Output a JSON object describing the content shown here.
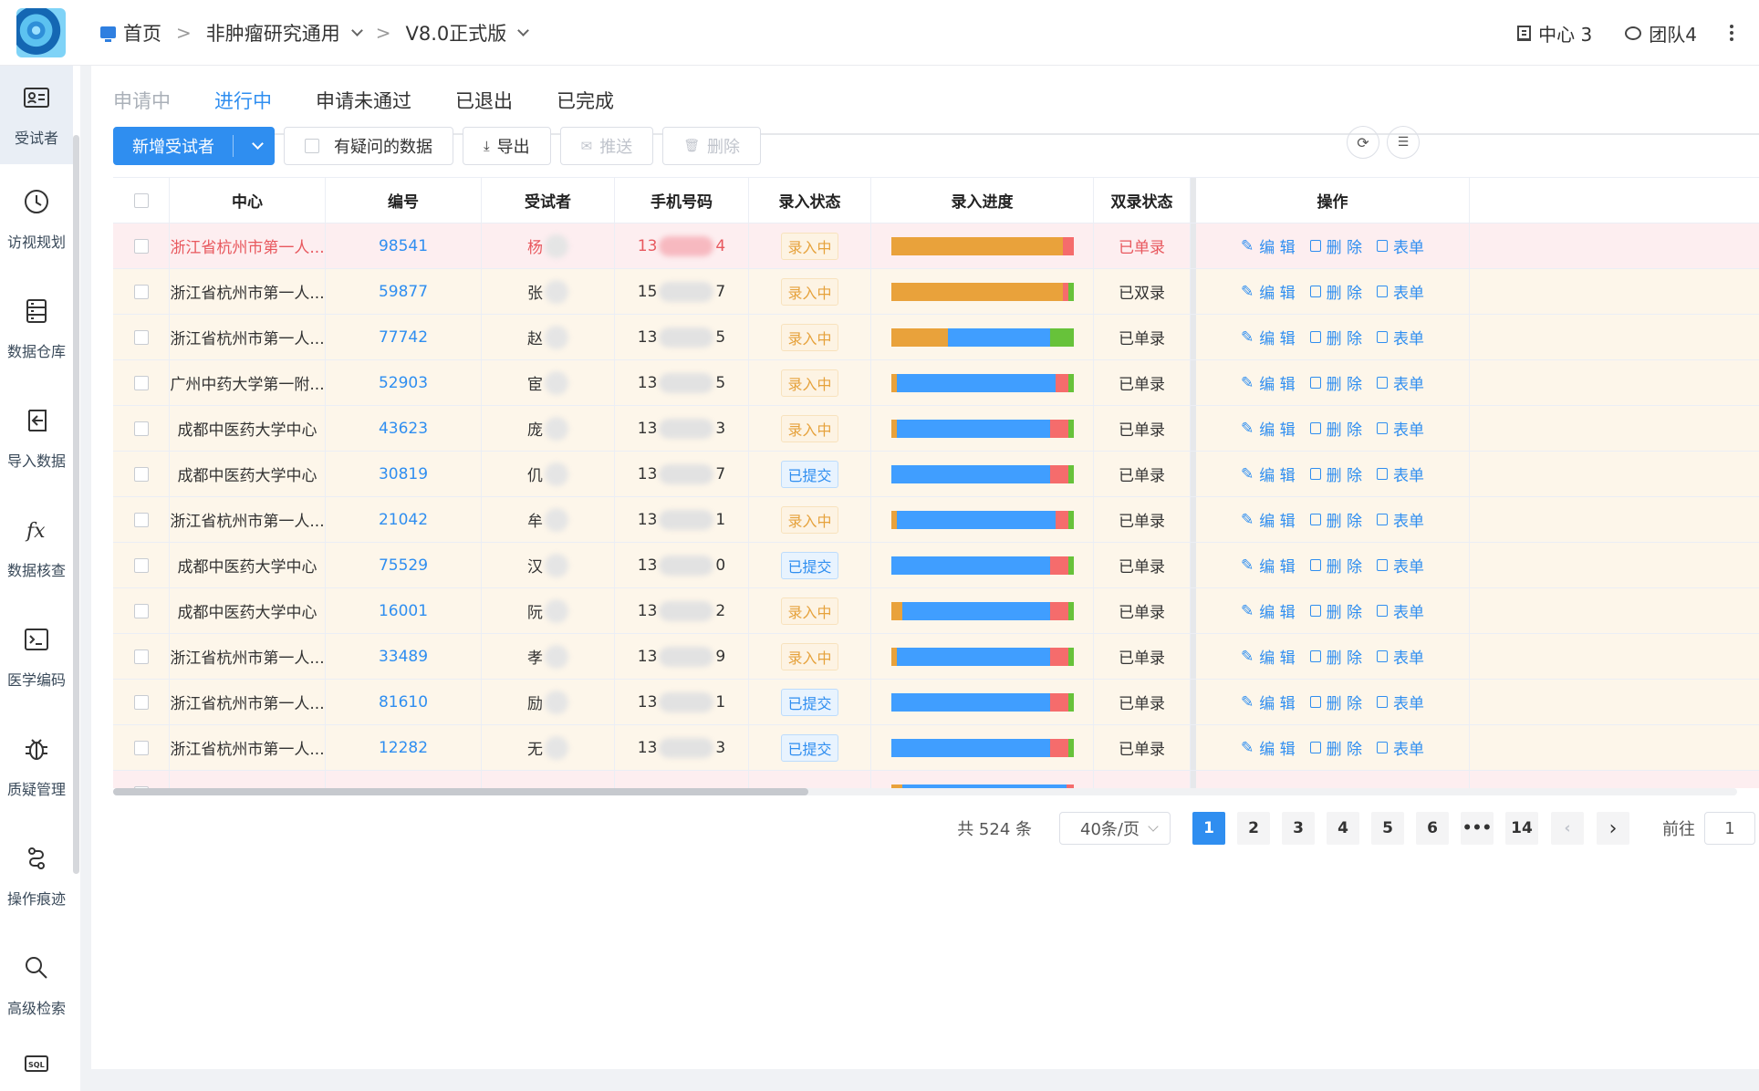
{
  "header": {
    "breadcrumb": [
      "首页",
      "非肿瘤研究通用",
      "V8.0正式版"
    ],
    "center_count": "中心 3",
    "team_count": "团队4"
  },
  "sidebar": {
    "items": [
      {
        "label": "受试者",
        "icon": "id-card-icon"
      },
      {
        "label": "访视规划",
        "icon": "clock-icon"
      },
      {
        "label": "数据仓库",
        "icon": "database-icon"
      },
      {
        "label": "导入数据",
        "icon": "import-icon"
      },
      {
        "label": "数据核查",
        "icon": "fx-icon"
      },
      {
        "label": "医学编码",
        "icon": "terminal-icon"
      },
      {
        "label": "质疑管理",
        "icon": "bug-icon"
      },
      {
        "label": "操作痕迹",
        "icon": "trail-icon"
      },
      {
        "label": "高级检索",
        "icon": "search-icon"
      },
      {
        "label": "",
        "icon": "sql-icon"
      }
    ]
  },
  "tabs": [
    "申请中",
    "进行中",
    "申请未通过",
    "已退出",
    "已完成"
  ],
  "toolbar": {
    "add": "新增受试者",
    "doubtful": "有疑问的数据",
    "export": "导出",
    "push": "推送",
    "delete": "删除"
  },
  "table": {
    "columns": [
      "中心",
      "编号",
      "受试者",
      "手机号码",
      "录入状态",
      "录入进度",
      "双录状态",
      "操作"
    ],
    "ops": {
      "edit": "编 辑",
      "delete": "删 除",
      "form": "表单"
    },
    "colors": {
      "orange": "#e9a23b",
      "blue": "#409eff",
      "red": "#f56c6c",
      "green": "#67c23a"
    },
    "rows": [
      {
        "center": "浙江省杭州市第一人...",
        "code": "98541",
        "name": "杨",
        "phone_pre": "13",
        "phone_suf": "4",
        "status": "录入中",
        "dual": "已单录",
        "progress": [
          0.94,
          0,
          0.06,
          0
        ],
        "style": "pink"
      },
      {
        "center": "浙江省杭州市第一人...",
        "code": "59877",
        "name": "张",
        "phone_pre": "15",
        "phone_suf": "7",
        "status": "录入中",
        "dual": "已双录",
        "progress": [
          0.94,
          0,
          0.03,
          0.03
        ],
        "style": "cream"
      },
      {
        "center": "浙江省杭州市第一人...",
        "code": "77742",
        "name": "赵",
        "phone_pre": "13",
        "phone_suf": "5",
        "status": "录入中",
        "dual": "已单录",
        "progress": [
          0.31,
          0.56,
          0,
          0.13
        ],
        "style": "cream"
      },
      {
        "center": "广州中药大学第一附...",
        "code": "52903",
        "name": "宦",
        "phone_pre": "13",
        "phone_suf": "5",
        "status": "录入中",
        "dual": "已单录",
        "progress": [
          0.03,
          0.87,
          0.07,
          0.03
        ],
        "style": "cream"
      },
      {
        "center": "成都中医药大学中心",
        "code": "43623",
        "name": "庞",
        "phone_pre": "13",
        "phone_suf": "3",
        "status": "录入中",
        "dual": "已单录",
        "progress": [
          0.03,
          0.84,
          0.1,
          0.03
        ],
        "style": "cream"
      },
      {
        "center": "成都中医药大学中心",
        "code": "30819",
        "name": "仉",
        "phone_pre": "13",
        "phone_suf": "7",
        "status": "已提交",
        "dual": "已单录",
        "progress": [
          0,
          0.87,
          0.1,
          0.03
        ],
        "style": "cream"
      },
      {
        "center": "浙江省杭州市第一人...",
        "code": "21042",
        "name": "牟",
        "phone_pre": "13",
        "phone_suf": "1",
        "status": "录入中",
        "dual": "已单录",
        "progress": [
          0.03,
          0.87,
          0.07,
          0.03
        ],
        "style": "cream"
      },
      {
        "center": "成都中医药大学中心",
        "code": "75529",
        "name": "汉",
        "phone_pre": "13",
        "phone_suf": "0",
        "status": "已提交",
        "dual": "已单录",
        "progress": [
          0,
          0.87,
          0.1,
          0.03
        ],
        "style": "cream"
      },
      {
        "center": "成都中医药大学中心",
        "code": "16001",
        "name": "阮",
        "phone_pre": "13",
        "phone_suf": "2",
        "status": "录入中",
        "dual": "已单录",
        "progress": [
          0.06,
          0.81,
          0.1,
          0.03
        ],
        "style": "cream"
      },
      {
        "center": "浙江省杭州市第一人...",
        "code": "33489",
        "name": "孝",
        "phone_pre": "13",
        "phone_suf": "9",
        "status": "录入中",
        "dual": "已单录",
        "progress": [
          0.03,
          0.84,
          0.1,
          0.03
        ],
        "style": "cream"
      },
      {
        "center": "浙江省杭州市第一人...",
        "code": "81610",
        "name": "励",
        "phone_pre": "13",
        "phone_suf": "1",
        "status": "已提交",
        "dual": "已单录",
        "progress": [
          0,
          0.87,
          0.1,
          0.03
        ],
        "style": "cream"
      },
      {
        "center": "浙江省杭州市第一人...",
        "code": "12282",
        "name": "无",
        "phone_pre": "13",
        "phone_suf": "3",
        "status": "已提交",
        "dual": "已单录",
        "progress": [
          0,
          0.87,
          0.1,
          0.03
        ],
        "style": "cream"
      },
      {
        "center": "",
        "code": "",
        "name": "",
        "phone_pre": "",
        "phone_suf": "",
        "status": "",
        "dual": "",
        "progress": [
          0.06,
          0.9,
          0.04,
          0
        ],
        "style": "pink"
      }
    ]
  },
  "pagination": {
    "total": "共 524 条",
    "page_size": "40条/页",
    "pages": [
      "1",
      "2",
      "3",
      "4",
      "5",
      "6",
      "•••",
      "14"
    ],
    "current": "1",
    "goto_label": "前往",
    "goto_value": "1"
  }
}
